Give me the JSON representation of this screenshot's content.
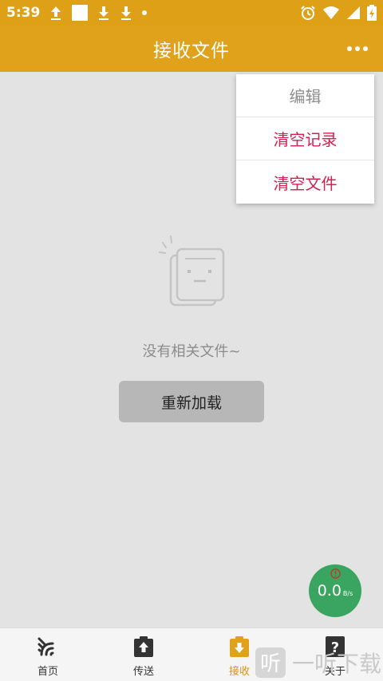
{
  "status_bar": {
    "time": "5:39",
    "left_icons": [
      "upload-icon",
      "square-icon",
      "download-icon",
      "download-icon",
      "dot-icon"
    ],
    "right_icons": [
      "alarm-icon",
      "wifi-icon",
      "signal-icon",
      "battery-icon"
    ]
  },
  "app_bar": {
    "title": "接收文件",
    "more_icon": "more-dots-icon"
  },
  "menu": {
    "items": [
      {
        "label": "编辑"
      },
      {
        "label": "清空记录"
      },
      {
        "label": "清空文件"
      }
    ]
  },
  "empty_state": {
    "text": "没有相关文件~",
    "reload_label": "重新加载"
  },
  "speed": {
    "value": "0.0",
    "unit": "B/s"
  },
  "bottom_nav": {
    "tabs": [
      {
        "label": "首页",
        "icon": "signal-waves-icon"
      },
      {
        "label": "传送",
        "icon": "send-upload-icon"
      },
      {
        "label": "接收",
        "icon": "receive-download-icon"
      },
      {
        "label": "关于",
        "icon": "question-icon"
      }
    ],
    "active_index": 2
  },
  "watermark": {
    "text": "一听下载",
    "logo_char": "听"
  },
  "colors": {
    "app_bar": "#e0a21b",
    "active_tab": "#d99410",
    "danger": "#d41f4f",
    "speed_badge": "#3aa560"
  }
}
